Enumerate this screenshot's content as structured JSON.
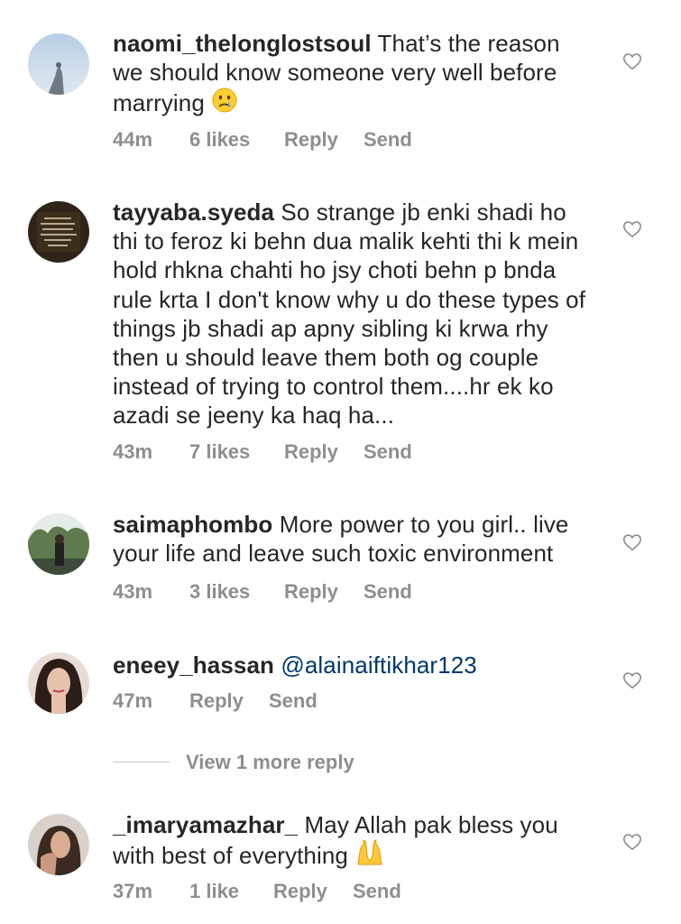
{
  "comments": [
    {
      "username": "naomi_thelonglostsoul",
      "text": "That’s the reason we should know someone very well before marrying",
      "emoji": "crying-face",
      "time": "44m",
      "likes": "6 likes",
      "reply": "Reply",
      "send": "Send"
    },
    {
      "username": "tayyaba.syeda",
      "text": "So strange jb enki shadi ho thi to feroz ki behn dua malik kehti thi k mein hold rhkna chahti ho jsy choti behn p bnda rule krta I don't know why u do these types of things jb shadi ap apny sibling ki krwa rhy then u should leave them both og couple instead of trying to control them....hr ek ko azadi se jeeny ka haq ha...",
      "time": "43m",
      "likes": "7 likes",
      "reply": "Reply",
      "send": "Send"
    },
    {
      "username": "saimaphombo",
      "text": "More power to you girl.. live your life and leave such toxic environment",
      "time": "43m",
      "likes": "3 likes",
      "reply": "Reply",
      "send": "Send"
    },
    {
      "username": "eneey_hassan",
      "mention": "@alainaiftikhar123",
      "time": "47m",
      "reply": "Reply",
      "send": "Send"
    },
    {
      "username": "_imaryamazhar_",
      "text": "May Allah pak bless you with best of everything",
      "emoji": "praying-hands",
      "time": "37m",
      "likes": "1 like",
      "reply": "Reply",
      "send": "Send"
    }
  ],
  "view_more": "View 1 more reply",
  "icons": {
    "like": "heart-outline-icon"
  },
  "colors": {
    "text": "#262626",
    "meta": "#8e8e8e",
    "mention": "#00376b",
    "divider": "#c7c7c7"
  }
}
